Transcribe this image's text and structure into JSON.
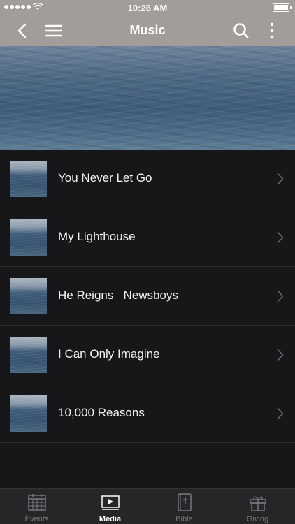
{
  "status_bar": {
    "time": "10:26 AM"
  },
  "nav": {
    "title": "Music"
  },
  "items": [
    {
      "label": "You Never Let Go"
    },
    {
      "label": "My Lighthouse"
    },
    {
      "label": "He Reigns   Newsboys"
    },
    {
      "label": "I Can Only Imagine"
    },
    {
      "label": "10,000 Reasons"
    }
  ],
  "tabs": [
    {
      "label": "Events",
      "icon": "calendar-icon"
    },
    {
      "label": "Media",
      "icon": "play-icon",
      "active": true
    },
    {
      "label": "Bible",
      "icon": "bible-icon"
    },
    {
      "label": "Giving",
      "icon": "gift-icon"
    }
  ],
  "colors": {
    "nav_bg": "#a39d99",
    "list_bg": "#171719",
    "tab_bg": "#262628"
  }
}
